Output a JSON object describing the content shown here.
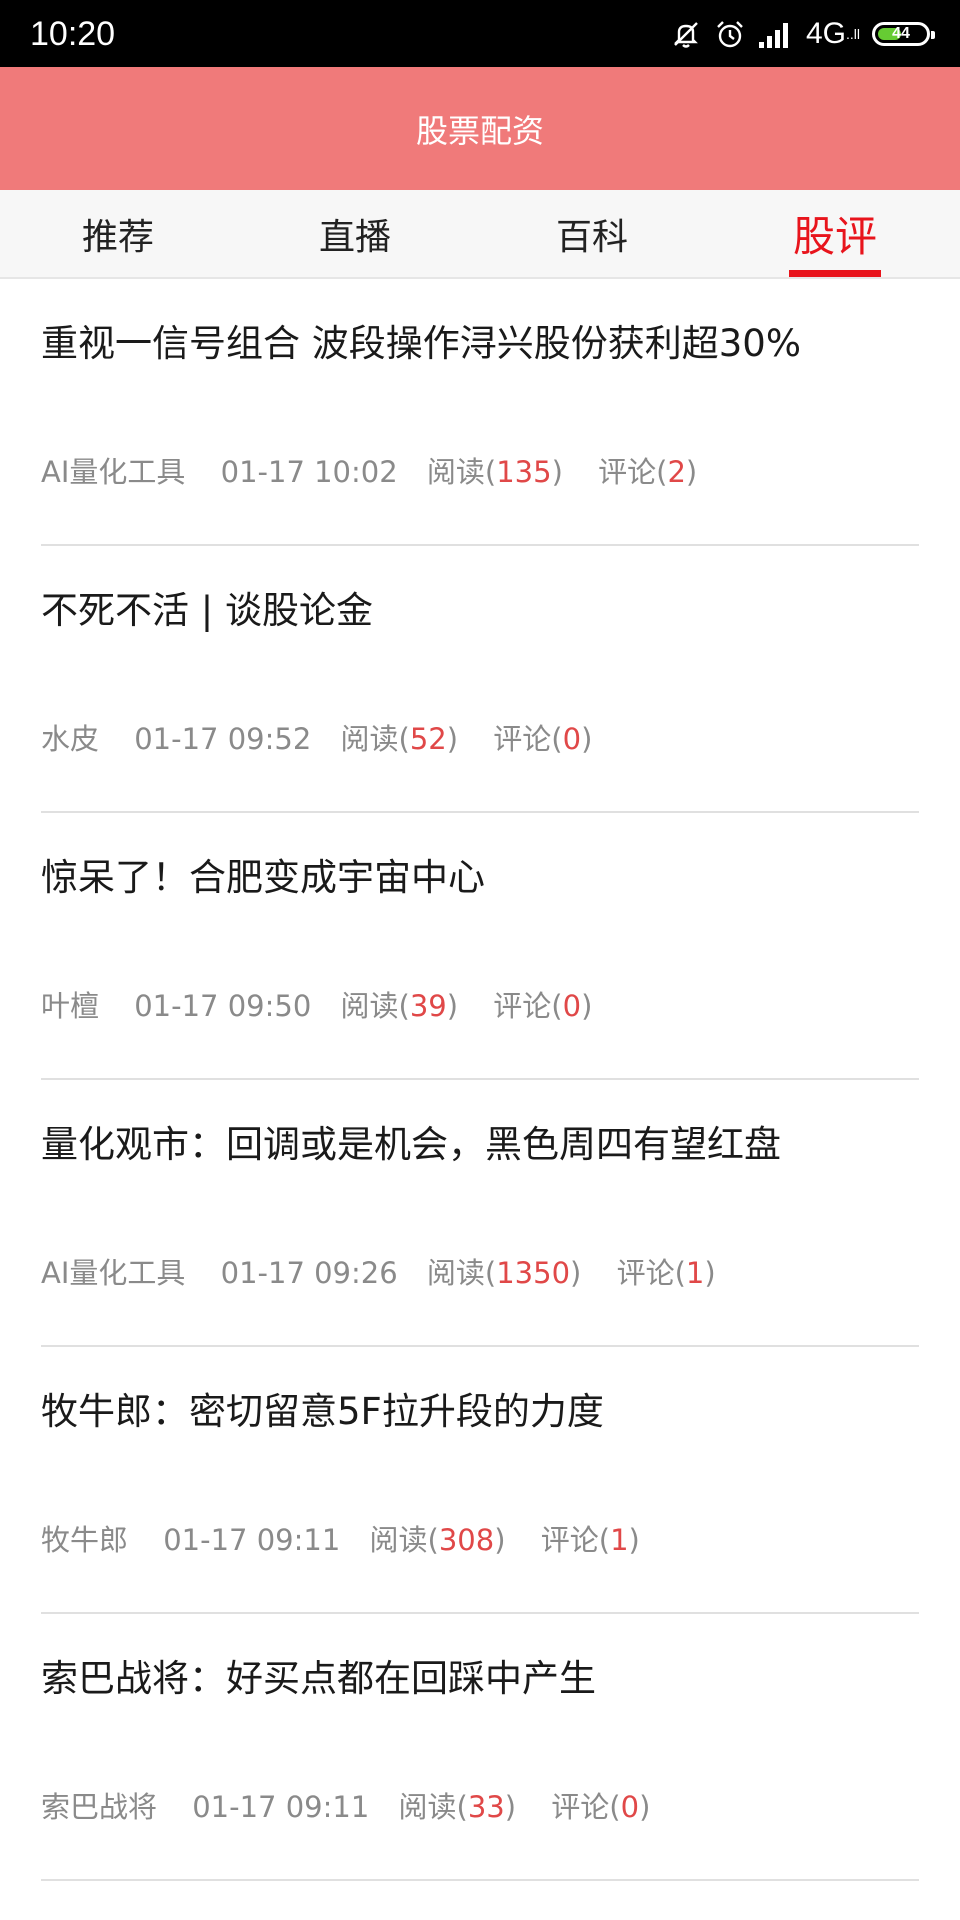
{
  "status_bar": {
    "time": "10:20",
    "network": "4G",
    "network_sub": "..ll",
    "battery": "44",
    "icons": [
      "mute-icon",
      "alarm-icon",
      "signal-icon",
      "battery-icon"
    ]
  },
  "header": {
    "title": "股票配资"
  },
  "tabs": [
    {
      "label": "推荐"
    },
    {
      "label": "直播"
    },
    {
      "label": "百科"
    },
    {
      "label": "股评"
    }
  ],
  "articles": [
    {
      "title": "重视一信号组合 波段操作浔兴股份获利超30%",
      "author": "AI量化工具",
      "time": "01-17 10:02",
      "read_prefix": "阅读(",
      "reads": "135",
      "read_suffix": ")",
      "comment_prefix": "评论(",
      "comments": "2",
      "comment_suffix": ")"
    },
    {
      "title": "不死不活 | 谈股论金",
      "author": "水皮",
      "time": "01-17 09:52",
      "read_prefix": "阅读(",
      "reads": "52",
      "read_suffix": ")",
      "comment_prefix": "评论(",
      "comments": "0",
      "comment_suffix": ")"
    },
    {
      "title": "惊呆了！合肥变成宇宙中心",
      "author": "叶檀",
      "time": "01-17 09:50",
      "read_prefix": "阅读(",
      "reads": "39",
      "read_suffix": ")",
      "comment_prefix": "评论(",
      "comments": "0",
      "comment_suffix": ")"
    },
    {
      "title": "量化观市：回调或是机会，黑色周四有望红盘",
      "author": "AI量化工具",
      "time": "01-17 09:26",
      "read_prefix": "阅读(",
      "reads": "1350",
      "read_suffix": ")",
      "comment_prefix": "评论(",
      "comments": "1",
      "comment_suffix": ")"
    },
    {
      "title": "牧牛郎：密切留意5F拉升段的力度",
      "author": "牧牛郎",
      "time": "01-17 09:11",
      "read_prefix": "阅读(",
      "reads": "308",
      "read_suffix": ")",
      "comment_prefix": "评论(",
      "comments": "1",
      "comment_suffix": ")"
    },
    {
      "title": "索巴战将：好买点都在回踩中产生",
      "author": "索巴战将",
      "time": "01-17 09:11",
      "read_prefix": "阅读(",
      "reads": "33",
      "read_suffix": ")",
      "comment_prefix": "评论(",
      "comments": "0",
      "comment_suffix": ")"
    }
  ],
  "colors": {
    "header_bg": "#f07a7a",
    "accent": "#e8141c",
    "number": "#e04848"
  }
}
